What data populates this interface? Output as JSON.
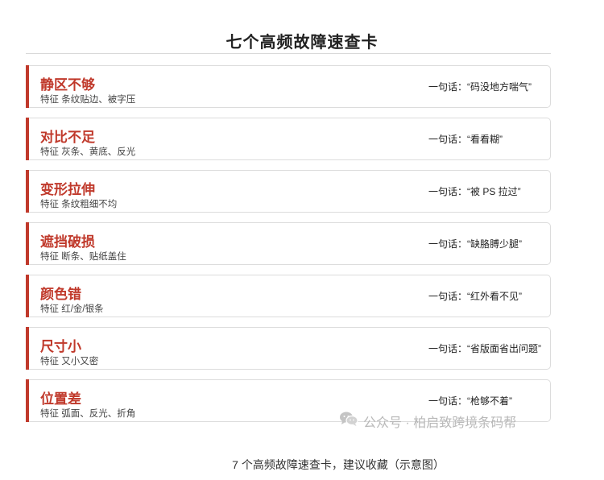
{
  "header": {
    "title": "七个高频故障速查卡"
  },
  "cards": [
    {
      "name": "静区不够",
      "feature": "特征 条纹贴边、被字压",
      "quote": "一句话：“码没地方喘气”"
    },
    {
      "name": "对比不足",
      "feature": "特征 灰条、黄底、反光",
      "quote": "一句话：“看看糊”"
    },
    {
      "name": "变形拉伸",
      "feature": "特征 条纹粗细不均",
      "quote": "一句话：“被 PS 拉过”"
    },
    {
      "name": "遮挡破损",
      "feature": "特征 断条、贴纸盖住",
      "quote": "一句话：“缺胳膊少腿”"
    },
    {
      "name": "颜色错",
      "feature": "特征 红/金/银条",
      "quote": "一句话：“红外看不见”"
    },
    {
      "name": "尺寸小",
      "feature": "特征 又小又密",
      "quote": "一句话：“省版面省出问题”"
    },
    {
      "name": "位置差",
      "feature": "特征 弧面、反光、折角",
      "quote": "一句话：“枪够不着”"
    }
  ],
  "watermark": {
    "text": "公众号 · 柏启致跨境条码帮",
    "icon": "wechat-icon"
  },
  "caption": "7 个高频故障速查卡，建议收藏（示意图）",
  "colors": {
    "accent": "#c0392b",
    "border": "#dcdcdc"
  }
}
